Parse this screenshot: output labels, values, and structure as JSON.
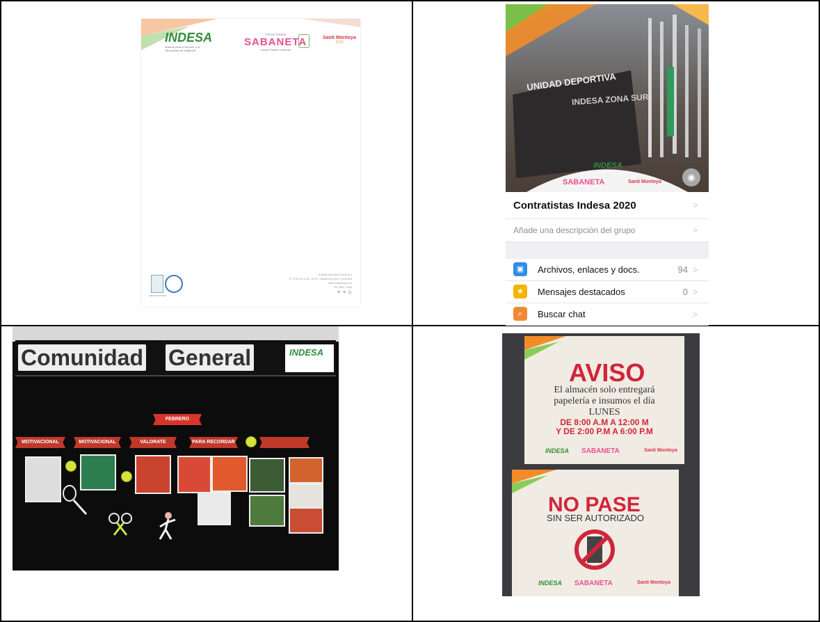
{
  "letterhead": {
    "logo": "INDESA",
    "logo_subtitle": "Instituto para el Deporte y la Recreación de Sabaneta",
    "sabaneta_top": "TODOS SOMOS",
    "sabaneta": "SABANETA",
    "sabaneta_bottom": "Ciudad Pueblo al Mundo",
    "mayor": "Santi Montoya",
    "mayor_year": "2020",
    "footer_lines": [
      "Unidad Deportiva Zona Sur",
      "Cl 76 B Sur # 46 - B 30 / Sabaneta (Ant.) Colombia",
      "www.indesa.gov.co",
      "Tel: 2887 9160"
    ],
    "badge_text": "RECERTIFICADO"
  },
  "phone": {
    "photo_wall_text_1": "UNIDAD DEPORTIVA",
    "photo_wall_text_2": "INDESA ZONA SUR",
    "group_name": "Contratistas Indesa 2020",
    "description_placeholder": "Añade una descripción del grupo",
    "items": [
      {
        "label": "Archivos, enlaces y docs.",
        "count": "94",
        "color": "#2f8de4",
        "icon": "photo-icon"
      },
      {
        "label": "Mensajes destacados",
        "count": "0",
        "color": "#f4b400",
        "icon": "star-icon"
      },
      {
        "label": "Buscar chat",
        "count": "",
        "color": "#f08a32",
        "icon": "search-icon"
      }
    ],
    "logo": "INDESA",
    "sabaneta": "SABANETA",
    "mayor": "Santi Montoya"
  },
  "board": {
    "words": [
      "Comunidad",
      "General"
    ],
    "logo": "INDESA",
    "month": "FEBRERO",
    "ribbons": [
      "MOTIVACIONAL",
      "MOTIVACIONAL",
      "VALORATE",
      "PARA RECORDAR",
      ""
    ]
  },
  "notices": {
    "aviso": {
      "title": "AVISO",
      "line1": "El almacén solo entregará",
      "line2": "papelería e insumos el día",
      "day": "LUNES",
      "time1": "DE 8:00 A.M A 12:00 M",
      "time2": "Y DE 2:00 P.M A 6:00 P.M"
    },
    "nopase": {
      "title": "NO PASE",
      "subtitle": "SIN SER AUTORIZADO"
    },
    "logo": "INDESA",
    "sabaneta": "SABANETA",
    "mayor": "Santi Montoya"
  }
}
